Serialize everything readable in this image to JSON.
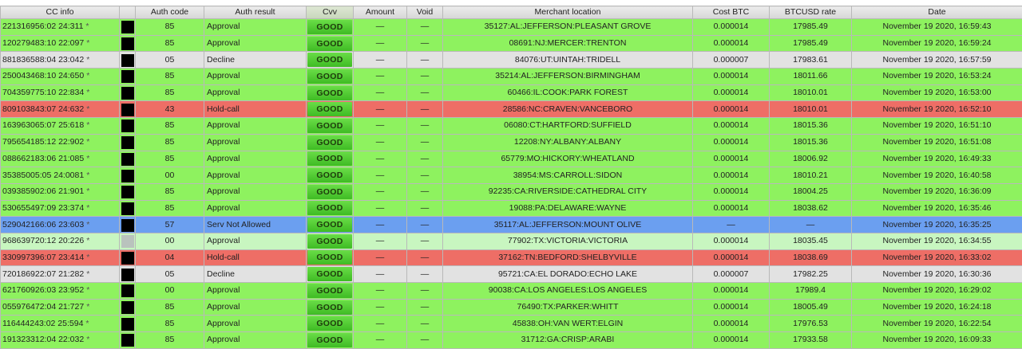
{
  "columns": {
    "cc_info": "CC info",
    "auth_code": "Auth code",
    "auth_result": "Auth result",
    "cvv": "Cvv",
    "amount": "Amount",
    "void": "Void",
    "merchant_location": "Merchant location",
    "cost_btc": "Cost BTC",
    "btcusd_rate": "BTCUSD rate",
    "date": "Date"
  },
  "status_colors": {
    "approval": "#8ef25f",
    "decline": "#e2e2e2",
    "hold_call": "#ee6e66",
    "serv_not_allowed": "#6b9ff0",
    "cvv_good": "#4ccb30"
  },
  "rows": [
    {
      "cc": "221316956:02 24:311",
      "mark": "*",
      "auth_code": "85",
      "auth_result": "Approval",
      "cvv": "GOOD",
      "amount": "—",
      "void": "—",
      "location": "35127:AL:JEFFERSON:PLEASANT GROVE",
      "cost": "0.000014",
      "rate": "17985.49",
      "date": "November 19 2020, 16:59:43",
      "status": "approve"
    },
    {
      "cc": "120279483:10 22:097",
      "mark": "*",
      "auth_code": "85",
      "auth_result": "Approval",
      "cvv": "GOOD",
      "amount": "—",
      "void": "—",
      "location": "08691:NJ:MERCER:TRENTON",
      "cost": "0.000014",
      "rate": "17985.49",
      "date": "November 19 2020, 16:59:24",
      "status": "approve"
    },
    {
      "cc": "881836588:04 23:042",
      "mark": "*",
      "auth_code": "05",
      "auth_result": "Decline",
      "cvv": "GOOD",
      "amount": "—",
      "void": "—",
      "location": "84076:UT:UINTAH:TRIDELL",
      "cost": "0.000007",
      "rate": "17983.61",
      "date": "November 19 2020, 16:57:59",
      "status": "decline"
    },
    {
      "cc": "250043468:10 24:650",
      "mark": "*",
      "auth_code": "85",
      "auth_result": "Approval",
      "cvv": "GOOD",
      "amount": "—",
      "void": "—",
      "location": "35214:AL:JEFFERSON:BIRMINGHAM",
      "cost": "0.000014",
      "rate": "18011.66",
      "date": "November 19 2020, 16:53:24",
      "status": "approve"
    },
    {
      "cc": "704359775:10 22:834",
      "mark": "*",
      "auth_code": "85",
      "auth_result": "Approval",
      "cvv": "GOOD",
      "amount": "—",
      "void": "—",
      "location": "60466:IL:COOK:PARK FOREST",
      "cost": "0.000014",
      "rate": "18010.01",
      "date": "November 19 2020, 16:53:00",
      "status": "approve"
    },
    {
      "cc": "809103843:07 24:632",
      "mark": "*",
      "auth_code": "43",
      "auth_result": "Hold-call",
      "cvv": "GOOD",
      "amount": "—",
      "void": "—",
      "location": "28586:NC:CRAVEN:VANCEBORO",
      "cost": "0.000014",
      "rate": "18010.01",
      "date": "November 19 2020, 16:52:10",
      "status": "hold"
    },
    {
      "cc": "163963065:07 25:618",
      "mark": "*",
      "auth_code": "85",
      "auth_result": "Approval",
      "cvv": "GOOD",
      "amount": "—",
      "void": "—",
      "location": "06080:CT:HARTFORD:SUFFIELD",
      "cost": "0.000014",
      "rate": "18015.36",
      "date": "November 19 2020, 16:51:10",
      "status": "approve"
    },
    {
      "cc": "795654185:12 22:902",
      "mark": "*",
      "auth_code": "85",
      "auth_result": "Approval",
      "cvv": "GOOD",
      "amount": "—",
      "void": "—",
      "location": "12208:NY:ALBANY:ALBANY",
      "cost": "0.000014",
      "rate": "18015.36",
      "date": "November 19 2020, 16:51:08",
      "status": "approve"
    },
    {
      "cc": "088662183:06 21:085",
      "mark": "*",
      "auth_code": "85",
      "auth_result": "Approval",
      "cvv": "GOOD",
      "amount": "—",
      "void": "—",
      "location": "65779:MO:HICKORY:WHEATLAND",
      "cost": "0.000014",
      "rate": "18006.92",
      "date": "November 19 2020, 16:49:33",
      "status": "approve"
    },
    {
      "cc": "35385005:05 24:0081",
      "mark": "*",
      "auth_code": "00",
      "auth_result": "Approval",
      "cvv": "GOOD",
      "amount": "—",
      "void": "—",
      "location": "38954:MS:CARROLL:SIDON",
      "cost": "0.000014",
      "rate": "18010.21",
      "date": "November 19 2020, 16:40:58",
      "status": "approve"
    },
    {
      "cc": "039385902:06 21:901",
      "mark": "*",
      "auth_code": "85",
      "auth_result": "Approval",
      "cvv": "GOOD",
      "amount": "—",
      "void": "—",
      "location": "92235:CA:RIVERSIDE:CATHEDRAL CITY",
      "cost": "0.000014",
      "rate": "18004.25",
      "date": "November 19 2020, 16:36:09",
      "status": "approve"
    },
    {
      "cc": "530655497:09 23:374",
      "mark": "*",
      "auth_code": "85",
      "auth_result": "Approval",
      "cvv": "GOOD",
      "amount": "—",
      "void": "—",
      "location": "19088:PA:DELAWARE:WAYNE",
      "cost": "0.000014",
      "rate": "18038.62",
      "date": "November 19 2020, 16:35:46",
      "status": "approve"
    },
    {
      "cc": "529042166:06 23:603",
      "mark": "*",
      "auth_code": "57",
      "auth_result": "Serv Not Allowed",
      "cvv": "GOOD",
      "amount": "—",
      "void": "—",
      "location": "35117:AL:JEFFERSON:MOUNT OLIVE",
      "cost": "—",
      "rate": "—",
      "date": "November 19 2020, 16:35:25",
      "status": "serv"
    },
    {
      "cc": "968639720:12 20:226",
      "mark": "*",
      "auth_code": "00",
      "auth_result": "Approval",
      "cvv": "GOOD",
      "amount": "—",
      "void": "—",
      "location": "77902:TX:VICTORIA:VICTORIA",
      "cost": "0.000014",
      "rate": "18035.45",
      "date": "November 19 2020, 16:34:55",
      "status": "soft"
    },
    {
      "cc": "330997396:07 23:414",
      "mark": "*",
      "auth_code": "04",
      "auth_result": "Hold-call",
      "cvv": "GOOD",
      "amount": "—",
      "void": "—",
      "location": "37162:TN:BEDFORD:SHELBYVILLE",
      "cost": "0.000014",
      "rate": "18038.69",
      "date": "November 19 2020, 16:33:02",
      "status": "hold"
    },
    {
      "cc": "720186922:07 21:282",
      "mark": "*",
      "auth_code": "05",
      "auth_result": "Decline",
      "cvv": "GOOD",
      "amount": "—",
      "void": "—",
      "location": "95721:CA:EL DORADO:ECHO LAKE",
      "cost": "0.000007",
      "rate": "17982.25",
      "date": "November 19 2020, 16:30:36",
      "status": "decline"
    },
    {
      "cc": "621760926:03 23:952",
      "mark": "*",
      "auth_code": "00",
      "auth_result": "Approval",
      "cvv": "GOOD",
      "amount": "—",
      "void": "—",
      "location": "90038:CA:LOS ANGELES:LOS ANGELES",
      "cost": "0.000014",
      "rate": "17989.4",
      "date": "November 19 2020, 16:29:02",
      "status": "approve"
    },
    {
      "cc": "055976472:04 21:727",
      "mark": "*",
      "auth_code": "85",
      "auth_result": "Approval",
      "cvv": "GOOD",
      "amount": "—",
      "void": "—",
      "location": "76490:TX:PARKER:WHITT",
      "cost": "0.000014",
      "rate": "18005.49",
      "date": "November 19 2020, 16:24:18",
      "status": "approve"
    },
    {
      "cc": "116444243:02 25:594",
      "mark": "*",
      "auth_code": "85",
      "auth_result": "Approval",
      "cvv": "GOOD",
      "amount": "—",
      "void": "—",
      "location": "45838:OH:VAN WERT:ELGIN",
      "cost": "0.000014",
      "rate": "17976.53",
      "date": "November 19 2020, 16:22:54",
      "status": "approve"
    },
    {
      "cc": "191323312:04 22:032",
      "mark": "*",
      "auth_code": "85",
      "auth_result": "Approval",
      "cvv": "GOOD",
      "amount": "—",
      "void": "—",
      "location": "31712:GA:CRISP:ARABI",
      "cost": "0.000014",
      "rate": "17933.58",
      "date": "November 19 2020, 16:09:33",
      "status": "approve"
    }
  ]
}
